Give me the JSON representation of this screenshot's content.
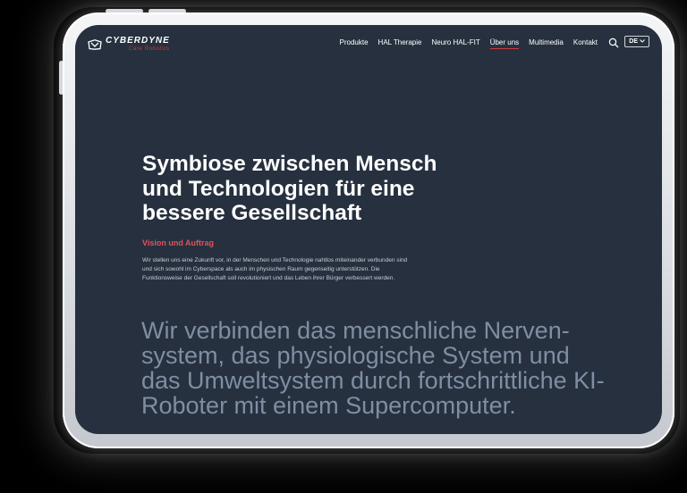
{
  "logo": {
    "name": "CYBERDYNE",
    "tagline": "Care Robotics"
  },
  "nav": {
    "items": [
      "Produkte",
      "HAL Therapie",
      "Neuro HAL-FIT",
      "Über uns",
      "Multimedia",
      "Kontakt"
    ],
    "active_index": 3
  },
  "lang": {
    "label": "DE"
  },
  "hero": {
    "title": "Symbiose zwischen Mensch und Technologien für eine bessere Gesellschaft",
    "subtitle": "Vision und Auftrag",
    "body": "Wir stellen uns eine Zukunft vor, in der Menschen und Technologie nahtlos miteinander verbunden sind und sich sowohl im Cyberspace als auch im physischen Raum gegenseitig unterstützen. Die Funktionsweise der Gesellschaft soll revolutioniert und das Leben ihrer Bürger verbessert werden.",
    "statement": "Wir verbinden das menschliche Nerven-system, das physiologische System und das Umweltsystem durch fortschrittliche KI-Roboter mit einem Supercomputer."
  },
  "colors": {
    "background": "#26303f",
    "accent": "#d23a3a",
    "text": "#ffffff",
    "muted": "#7f8ea2"
  },
  "icons": [
    "cyberdyne-logo-icon",
    "search-icon",
    "chevron-down-icon"
  ]
}
